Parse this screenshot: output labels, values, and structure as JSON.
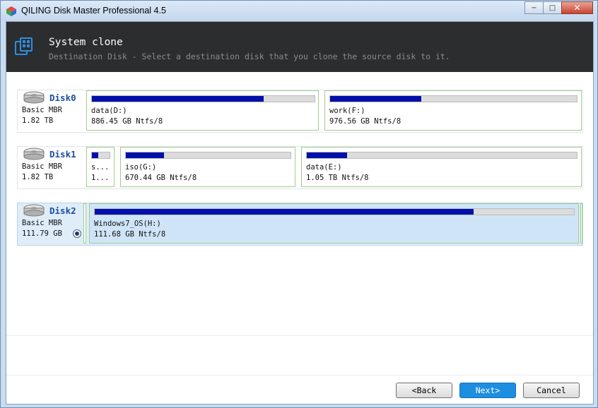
{
  "window": {
    "title": "QILING Disk Master Professional 4.5",
    "controls": {
      "minimize": "−",
      "maximize": "□",
      "close": "✕"
    }
  },
  "header": {
    "title": "System clone",
    "subtitle": "Destination Disk - Select a destination disk that you clone the source disk to it."
  },
  "disks": [
    {
      "name": "Disk0",
      "type": "Basic MBR",
      "size": "1.82 TB",
      "partitions": [
        {
          "label": "data(D:)",
          "size": "886.45 GB Ntfs/8",
          "usage": 0.77
        },
        {
          "label": "work(F:)",
          "size": "976.56 GB Ntfs/8",
          "usage": 0.37
        }
      ]
    },
    {
      "name": "Disk1",
      "type": "Basic MBR",
      "size": "1.82 TB",
      "partitions": [
        {
          "label": "s...",
          "size": "1...",
          "usage": 0.35
        },
        {
          "label": "iso(G:)",
          "size": "670.44 GB Ntfs/8",
          "usage": 0.23
        },
        {
          "label": "data(E:)",
          "size": "1.05 TB Ntfs/8",
          "usage": 0.15
        }
      ]
    },
    {
      "name": "Disk2",
      "type": "Basic MBR",
      "size": "111.79 GB",
      "selected": true,
      "partitions": [
        {
          "label": "Windows7_OS(H:)",
          "size": "111.68 GB Ntfs/8",
          "usage": 0.79
        }
      ]
    }
  ],
  "buttons": {
    "back": "<Back",
    "next": "Next>",
    "cancel": "Cancel"
  },
  "colors": {
    "header_bg": "#2b2d2f",
    "usage_fill": "#0010a8",
    "primary_button": "#1e8ee0",
    "partition_border": "#9fcd90",
    "selected_row": "#dfedf9"
  }
}
